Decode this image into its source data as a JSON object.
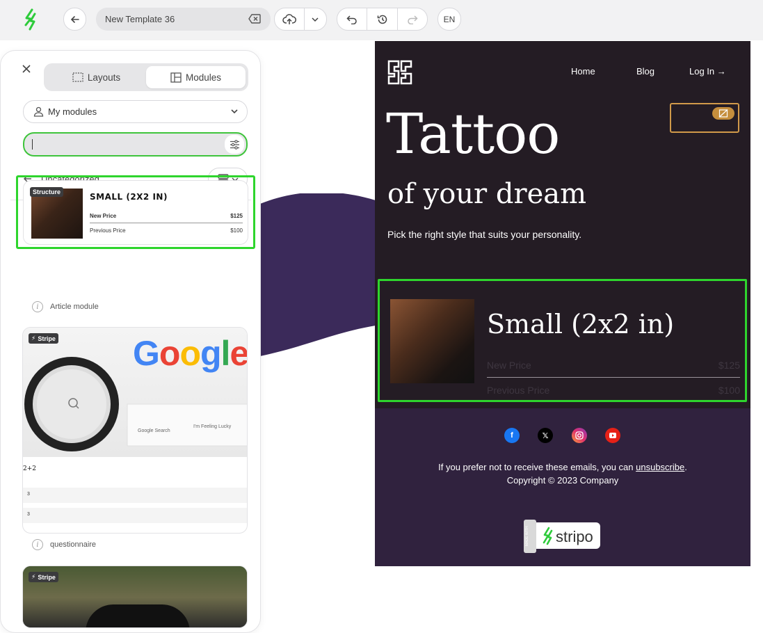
{
  "topbar": {
    "template_title": "New Template 36",
    "language": "EN"
  },
  "panel": {
    "tabs": [
      {
        "label": "Layouts",
        "icon": "layouts-icon",
        "active": false
      },
      {
        "label": "Modules",
        "icon": "modules-icon",
        "active": true
      }
    ],
    "source_dropdown": "My modules",
    "search_value": "",
    "category": "Uncategorized",
    "modules": [
      {
        "badge": "Structure",
        "title": "SMALL (2X2 IN)",
        "rows": [
          {
            "label": "New Price",
            "value": "$125"
          },
          {
            "label": "Previous Price",
            "value": "$100"
          }
        ],
        "name": "Article module"
      },
      {
        "badge": "Stripe",
        "image_text": "Google",
        "lines": [
          "2+2",
          "3",
          "3"
        ],
        "name": "questionnaire"
      },
      {
        "badge": "Stripe"
      }
    ]
  },
  "email": {
    "nav": [
      "Home",
      "Blog",
      "Log In →"
    ],
    "hero_title": "Tattoo",
    "hero_subtitle": "of your dream",
    "hero_text": "Pick the right style that suits your personality.",
    "product": {
      "title": "Small (2x2 in)",
      "new_price_label": "New Price",
      "new_price": "$125",
      "prev_price_label": "Previous Price",
      "prev_price": "$100"
    },
    "socials": [
      "facebook-icon",
      "x-icon",
      "instagram-icon",
      "youtube-icon"
    ],
    "footer_text_before": "If you prefer not to receive these emails, you can ",
    "footer_link": "unsubscribe",
    "footer_text_after": ".",
    "copyright": "Copyright © 2023 Company",
    "badge": {
      "small": "MADE WITH",
      "brand": "stripo"
    }
  },
  "colors": {
    "accent_green": "#2ed52d",
    "email_bg": "#241c24",
    "footer_bg": "#30223e",
    "gold": "#d19a4a"
  }
}
